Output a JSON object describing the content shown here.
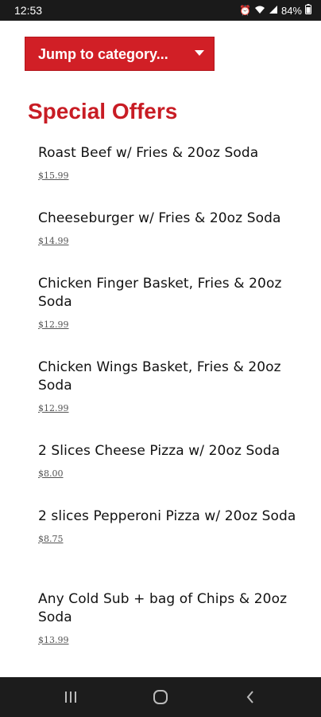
{
  "status_bar": {
    "time": "12:53",
    "battery": "84%"
  },
  "jump_button": {
    "label": "Jump to category..."
  },
  "section": {
    "title": "Special Offers"
  },
  "items": [
    {
      "name": "Roast Beef w/ Fries & 20oz Soda",
      "price": "$15.99"
    },
    {
      "name": "Cheeseburger w/ Fries & 20oz Soda",
      "price": "$14.99"
    },
    {
      "name": "Chicken Finger Basket, Fries & 20oz Soda",
      "price": "$12.99"
    },
    {
      "name": "Chicken Wings Basket, Fries & 20oz Soda",
      "price": "$12.99"
    },
    {
      "name": "2 Slices Cheese Pizza w/ 20oz Soda",
      "price": "$8.00"
    },
    {
      "name": "2 slices Pepperoni Pizza w/ 20oz Soda",
      "price": "$8.75"
    },
    {
      "name": "Any Cold Sub + bag of Chips & 20oz Soda",
      "price": "$13.99"
    }
  ],
  "colors": {
    "accent": "#d11f26",
    "title": "#c81c24"
  }
}
